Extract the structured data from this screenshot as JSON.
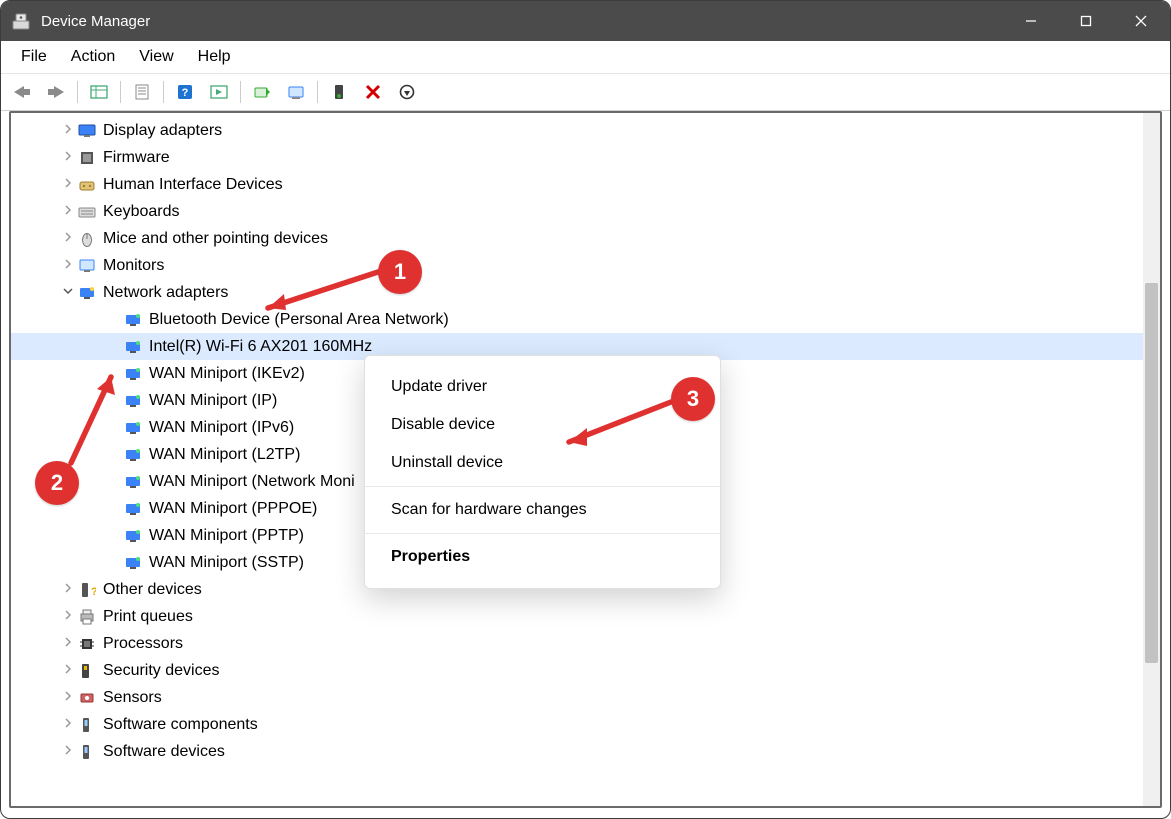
{
  "title": "Device Manager",
  "menu": {
    "file": "File",
    "action": "Action",
    "view": "View",
    "help": "Help"
  },
  "tree": {
    "categories": [
      {
        "label": "Display adapters",
        "icon": "display",
        "expanded": false
      },
      {
        "label": "Firmware",
        "icon": "chip",
        "expanded": false
      },
      {
        "label": "Human Interface Devices",
        "icon": "hid",
        "expanded": false
      },
      {
        "label": "Keyboards",
        "icon": "keyboard",
        "expanded": false
      },
      {
        "label": "Mice and other pointing devices",
        "icon": "mouse",
        "expanded": false
      },
      {
        "label": "Monitors",
        "icon": "monitor",
        "expanded": false
      },
      {
        "label": "Network adapters",
        "icon": "network",
        "expanded": true,
        "children": [
          {
            "label": "Bluetooth Device (Personal Area Network)",
            "selected": false
          },
          {
            "label": "Intel(R) Wi-Fi 6 AX201 160MHz",
            "selected": true
          },
          {
            "label": "WAN Miniport (IKEv2)"
          },
          {
            "label": "WAN Miniport (IP)"
          },
          {
            "label": "WAN Miniport (IPv6)"
          },
          {
            "label": "WAN Miniport (L2TP)"
          },
          {
            "label": "WAN Miniport (Network Moni"
          },
          {
            "label": "WAN Miniport (PPPOE)"
          },
          {
            "label": "WAN Miniport (PPTP)"
          },
          {
            "label": "WAN Miniport (SSTP)"
          }
        ]
      },
      {
        "label": "Other devices",
        "icon": "other",
        "expanded": false
      },
      {
        "label": "Print queues",
        "icon": "printer",
        "expanded": false
      },
      {
        "label": "Processors",
        "icon": "cpu",
        "expanded": false
      },
      {
        "label": "Security devices",
        "icon": "security",
        "expanded": false
      },
      {
        "label": "Sensors",
        "icon": "sensor",
        "expanded": false
      },
      {
        "label": "Software components",
        "icon": "sw",
        "expanded": false
      },
      {
        "label": "Software devices",
        "icon": "sw",
        "expanded": false
      }
    ]
  },
  "context_menu": {
    "update": "Update driver",
    "disable": "Disable device",
    "uninstall": "Uninstall device",
    "scan": "Scan for hardware changes",
    "properties": "Properties"
  },
  "annotations": {
    "b1": "1",
    "b2": "2",
    "b3": "3"
  }
}
